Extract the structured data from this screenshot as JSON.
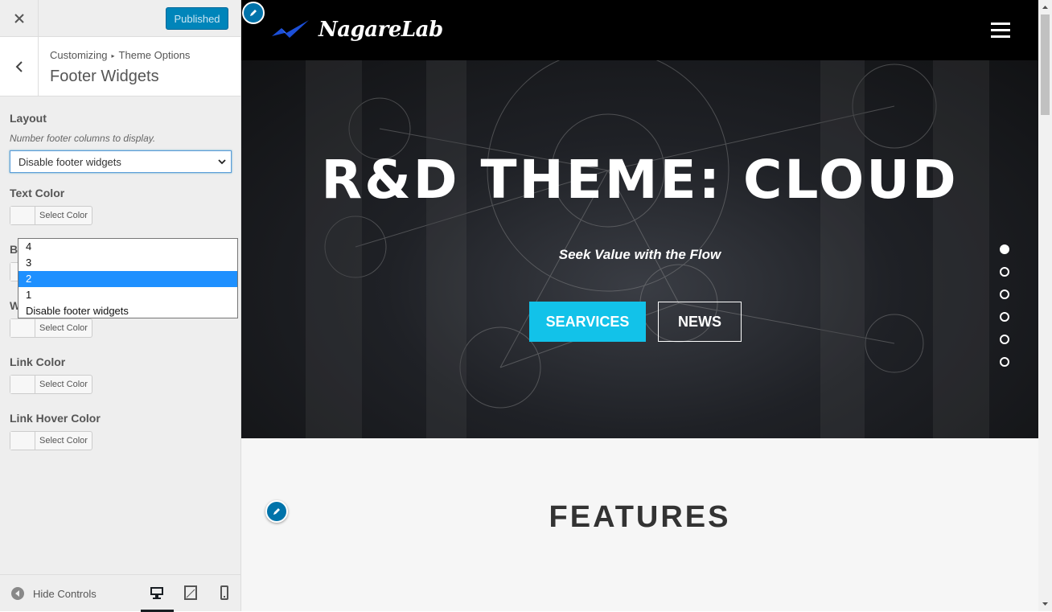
{
  "topbar": {
    "close_icon": "close-icon",
    "publish_label": "Published",
    "publish_color": "#0085ba"
  },
  "section": {
    "breadcrumb_parent": "Customizing",
    "breadcrumb_child": "Theme Options",
    "title": "Footer Widgets"
  },
  "controls": {
    "layout_label": "Layout",
    "layout_desc": "Number footer columns to display.",
    "layout_value": "Disable footer widgets",
    "text_color_label": "Text Color",
    "link_color_label": "Link Color",
    "link_hover_label": "Link Hover Color",
    "hidden_b_label": "B",
    "hidden_w_label": "W",
    "select_color": "Select Color"
  },
  "dropdown": {
    "options": [
      "4",
      "3",
      "2",
      "1",
      "Disable footer widgets"
    ],
    "highlighted": "2",
    "highlight_color": "#1e90ff"
  },
  "footer": {
    "hide_controls": "Hide Controls",
    "devices": [
      "desktop-icon",
      "tablet-icon",
      "mobile-icon"
    ],
    "active_device": "desktop"
  },
  "preview": {
    "logo_text": "NagareLab",
    "hero_title": "R&D THEME: CLOUD",
    "hero_subtitle": "Seek Value with the Flow",
    "btn_primary": "SEARVICES",
    "btn_secondary": "NEWS",
    "accent": "#12c2e9",
    "slider_dots": 6,
    "active_dot": 1,
    "features_title": "FEATURES"
  }
}
